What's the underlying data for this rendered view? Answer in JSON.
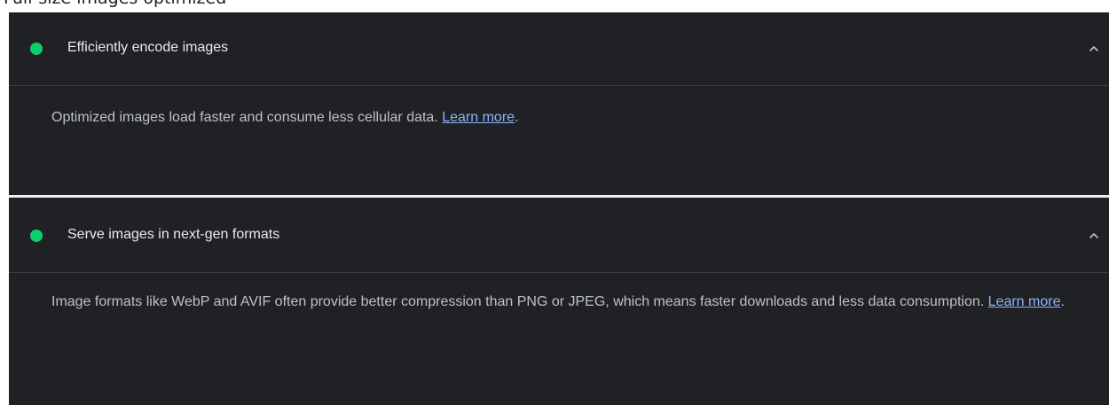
{
  "page": {
    "top_strip_text": "Full-size images optimized"
  },
  "colors": {
    "panel_background": "#202124",
    "pass_status": "#0cce6b",
    "link": "#8ab4f8"
  },
  "audits": [
    {
      "status": "pass",
      "status_icon": "green-circle-icon",
      "title": "Efficiently encode images",
      "expanded": true,
      "toggle_icon": "chevron-up-icon",
      "description": "Optimized images load faster and consume less cellular data.",
      "link_text": "Learn more",
      "trailing": "."
    },
    {
      "status": "pass",
      "status_icon": "green-circle-icon",
      "title": "Serve images in next-gen formats",
      "expanded": true,
      "toggle_icon": "chevron-up-icon",
      "description": "Image formats like WebP and AVIF often provide better compression than PNG or JPEG, which means faster downloads and less data consumption.",
      "link_text": "Learn more",
      "trailing": "."
    }
  ]
}
